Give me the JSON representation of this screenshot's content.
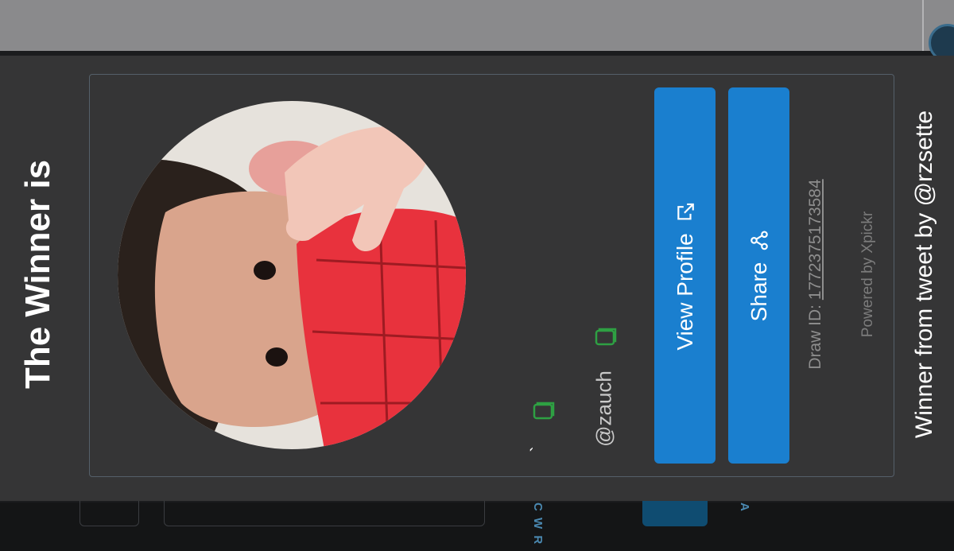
{
  "modal": {
    "title": "The Winner is",
    "winner": {
      "name": "`",
      "handle": "@zauch"
    },
    "buttons": {
      "view_profile": "View Profile",
      "share": "Share"
    },
    "draw": {
      "label": "Draw ID: ",
      "id": "1772375173584"
    },
    "powered_by": "Powered by Xpickr",
    "tweet_caption": "Winner from tweet by @rzsette"
  },
  "background": {
    "letters_left": "C W R",
    "letters_right": "A"
  },
  "icons": {
    "copy": "copy-icon",
    "external_link": "external-link-icon",
    "share": "share-icon"
  },
  "colors": {
    "modal_bg": "#353536",
    "button": "#1a7fcf",
    "copy_icon": "#2ea043",
    "title": "#ffffff"
  }
}
